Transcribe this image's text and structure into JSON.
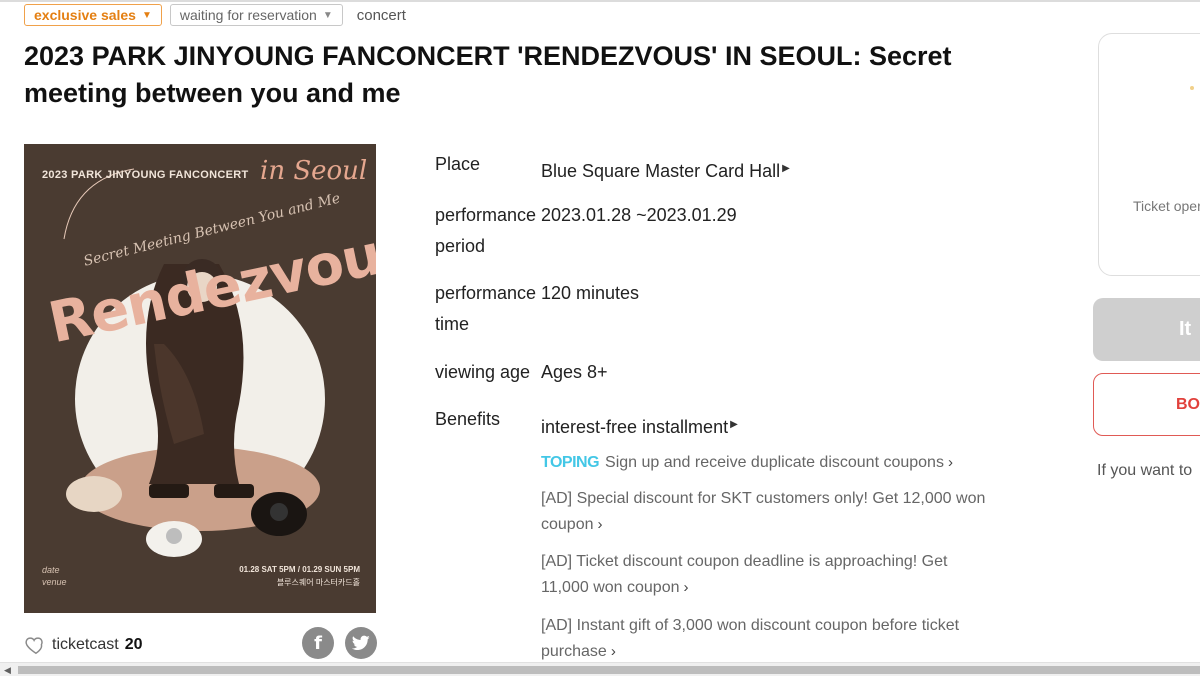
{
  "tags": {
    "exclusive": "exclusive sales",
    "reservation": "waiting for reservation",
    "category": "concert"
  },
  "title": "2023 PARK JINYOUNG FANCONCERT 'RENDEZVOUS' IN SEOUL: Secret meeting between you and me",
  "poster": {
    "header": "2023 PARK JINYOUNG FANCONCERT",
    "script_title": "in Seoul",
    "subtitle": "Secret Meeting Between You and Me",
    "main_word": "Rendezvous",
    "date_label": "date",
    "venue_label": "venue",
    "date_text": "01.28 SAT 5PM / 01.29 SUN 5PM",
    "venue_text": "블루스퀘어 마스터카드홀"
  },
  "likes": {
    "source": "ticketcast",
    "count": "20"
  },
  "info": {
    "place_label": "Place",
    "place_value": "Blue Square Master Card Hall",
    "period_label_1": "performance",
    "period_label_2": "period",
    "period_value": "2023.01.28 ~2023.01.29",
    "time_label_1": "performance",
    "time_label_2": "time",
    "time_value": "120 minutes",
    "age_label": "viewing age",
    "age_value": "Ages 8+",
    "benefits_label": "Benefits",
    "benefits_value": "interest-free installment",
    "toping_brand": "TOPING",
    "toping_text": "Sign up and receive duplicate discount coupons",
    "ad1_line1": "[AD] Special discount for SKT customers only! Get 12,000 won",
    "ad1_line2": "coupon",
    "ad2_line1": "[AD] Ticket discount coupon deadline is approaching! Get",
    "ad2_line2": "11,000 won coupon",
    "ad3_line1": "[AD] Instant gift of 3,000 won discount coupon before ticket",
    "ad3_line2": "purchase"
  },
  "side": {
    "panel_text": "Ticket oper",
    "gray_button": "It",
    "red_button": "BO",
    "note": "If you want to"
  },
  "colors": {
    "exclusive_orange": "#e47f12",
    "toping_blue": "#43c7e6",
    "book_red": "#e1413c",
    "poster_brown": "#4a3b31"
  }
}
